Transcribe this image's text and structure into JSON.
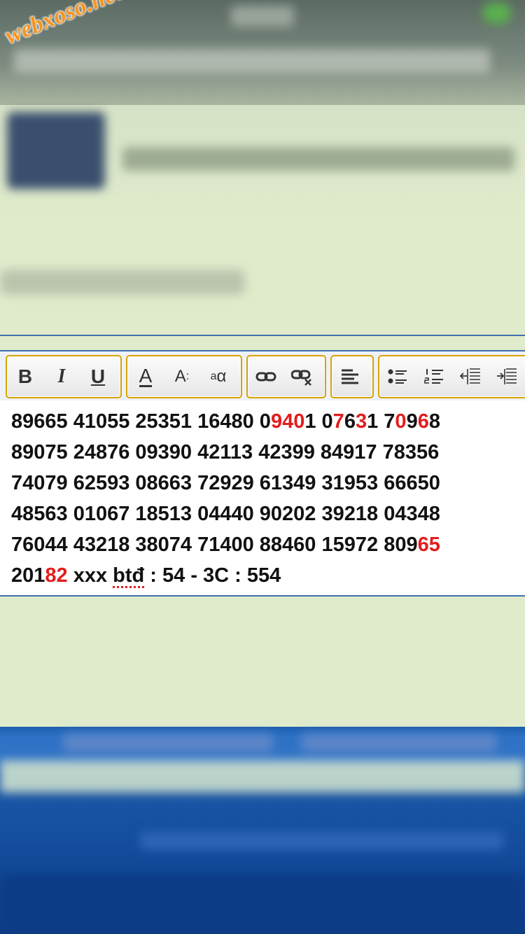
{
  "watermark": "webxoso.net",
  "toolbar": {
    "bold": "B",
    "italic": "I",
    "underline": "U",
    "font_color": "A",
    "font_size": "A",
    "font_family": "a"
  },
  "editor": {
    "lines": [
      [
        {
          "t": "89665 41055 25351 16480 0"
        },
        {
          "t": "94",
          "r": true
        },
        {
          "t": "0",
          "r": true
        },
        {
          "t": "1 0"
        },
        {
          "t": "7",
          "r": true
        },
        {
          "t": "6"
        },
        {
          "t": "3",
          "r": true
        },
        {
          "t": "1 7"
        },
        {
          "t": "0",
          "r": true
        },
        {
          "t": "9"
        },
        {
          "t": "6",
          "r": true
        },
        {
          "t": "8"
        }
      ],
      [
        {
          "t": "89075 24876 09390 42113 42399 84917 78356"
        }
      ],
      [
        {
          "t": "74079 62593 08663 72929 61349 31953 66650"
        }
      ],
      [
        {
          "t": "48563 01067 18513 04440 90202 39218 04348"
        }
      ],
      [
        {
          "t": "76044 43218 38074 71400 88460 15972 809"
        },
        {
          "t": "65",
          "r": true
        }
      ],
      [
        {
          "t": "201"
        },
        {
          "t": "82",
          "r": true
        },
        {
          "t": " xxx "
        },
        {
          "t": "btđ",
          "s": true
        },
        {
          "t": " : 54 - 3C : 554"
        }
      ]
    ]
  },
  "colors": {
    "background": "#dfebcb",
    "accent_border": "#3f6fae",
    "group_border": "#d8a200",
    "highlight_red": "#e31d1d",
    "watermark": "#f7941d"
  }
}
